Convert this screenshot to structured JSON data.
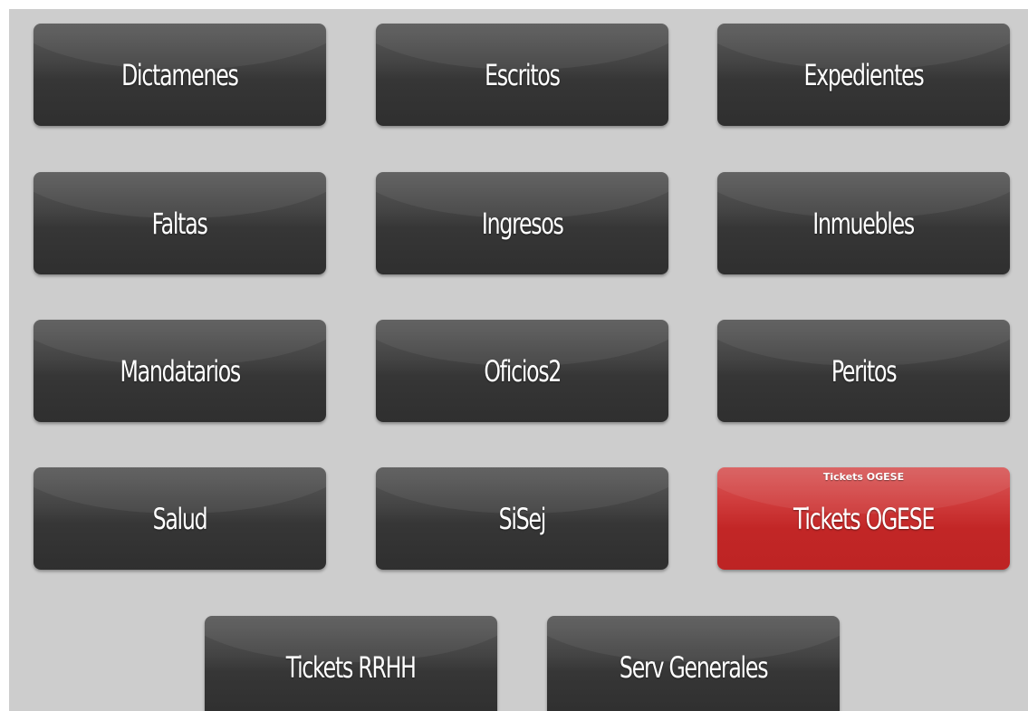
{
  "tiles": [
    {
      "label": "Dictamenes"
    },
    {
      "label": "Escritos"
    },
    {
      "label": "Expedientes"
    },
    {
      "label": "Faltas"
    },
    {
      "label": "Ingresos"
    },
    {
      "label": "Inmuebles"
    },
    {
      "label": "Mandatarios"
    },
    {
      "label": "Oficios2"
    },
    {
      "label": "Peritos"
    },
    {
      "label": "Salud"
    },
    {
      "label": "SiSej"
    },
    {
      "label": "Tickets OGESE",
      "badge": "Tickets OGESE",
      "accent": "#c62828"
    },
    {
      "label": "Tickets RRHH"
    },
    {
      "label": "Serv Generales"
    }
  ],
  "colors": {
    "background": "#cdcdcd",
    "tile": "#363636",
    "highlight": "#c62828",
    "text": "#ffffff"
  }
}
